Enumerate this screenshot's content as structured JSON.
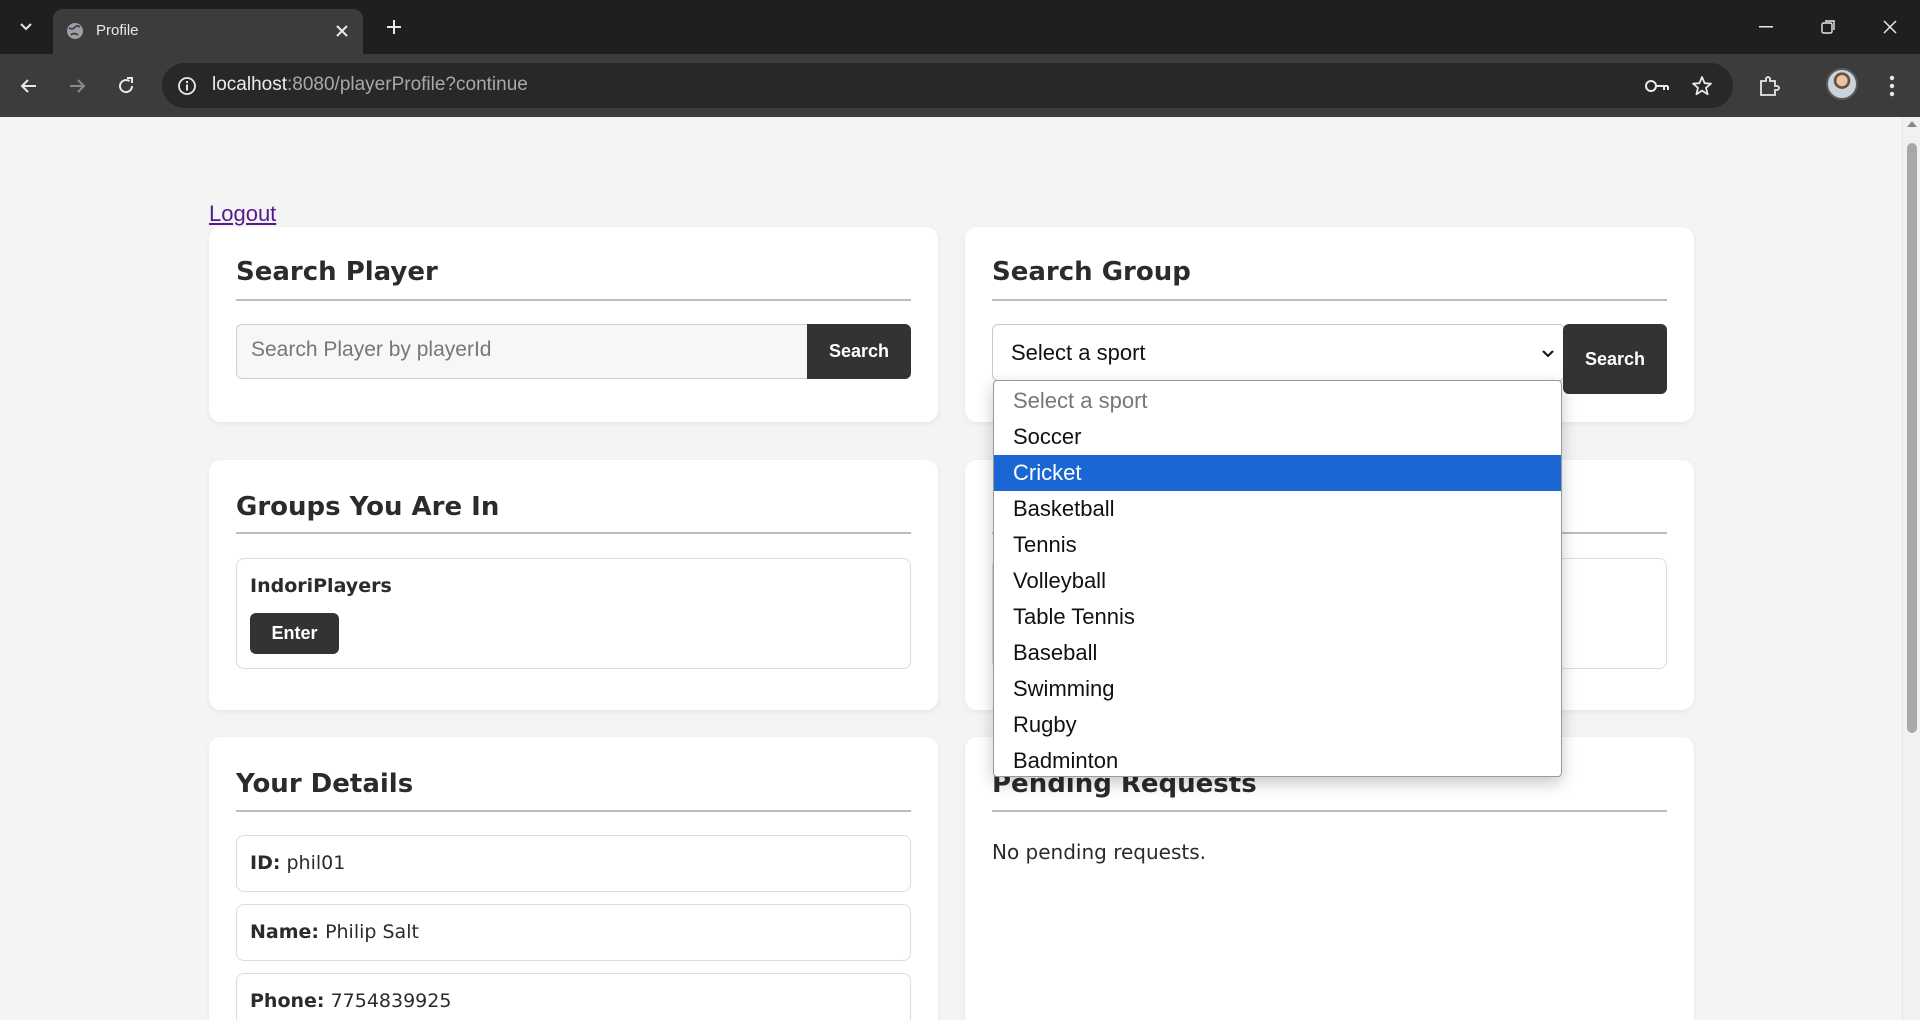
{
  "browser": {
    "tab_title": "Profile",
    "url_host": "localhost",
    "url_path": ":8080/playerProfile?continue"
  },
  "page": {
    "logout_label": "Logout",
    "search_player": {
      "title": "Search Player",
      "placeholder": "Search Player by playerId",
      "button_label": "Search"
    },
    "search_group": {
      "title": "Search Group",
      "selected_value": "Select a sport",
      "button_label": "Search",
      "options": [
        "Select a sport",
        "Soccer",
        "Cricket",
        "Basketball",
        "Tennis",
        "Volleyball",
        "Table Tennis",
        "Baseball",
        "Swimming",
        "Rugby",
        "Badminton"
      ],
      "highlighted_option": "Cricket"
    },
    "groups": {
      "title": "Groups You Are In",
      "items": [
        {
          "name": "IndoriPlayers",
          "button_label": "Enter"
        }
      ]
    },
    "details": {
      "title": "Your Details",
      "id_label": "ID:",
      "id_value": "phil01",
      "name_label": "Name:",
      "name_value": "Philip Salt",
      "phone_label": "Phone:",
      "phone_value": "7754839925"
    },
    "pending": {
      "title": "Pending Requests",
      "message": "No pending requests."
    }
  },
  "colors": {
    "page_bg": "#f4f4f4",
    "button_dark": "#333333",
    "highlight": "#1a66d2",
    "link_visited": "#551a8b"
  }
}
